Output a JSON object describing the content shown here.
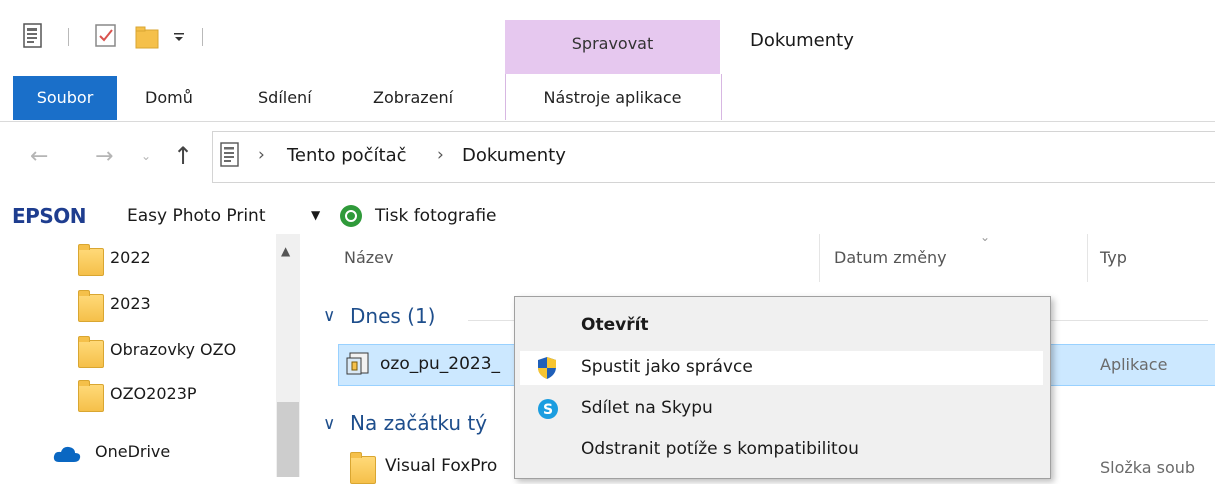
{
  "window": {
    "title": "Dokumenty"
  },
  "ribbon": {
    "contextual_group": "Spravovat",
    "tabs": [
      "Soubor",
      "Domů",
      "Sdílení",
      "Zobrazení",
      "Nástroje aplikace"
    ],
    "active_tab": "Soubor"
  },
  "address_bar": {
    "segments": [
      "Tento počítač",
      "Dokumenty"
    ],
    "separator": "›"
  },
  "epson_toolbar": {
    "brand": "EPSON",
    "app": "Easy Photo Print",
    "action": "Tisk fotografie"
  },
  "nav_pane": {
    "items": [
      {
        "label": "2022",
        "icon": "folder-icon"
      },
      {
        "label": "2023",
        "icon": "folder-icon"
      },
      {
        "label": "Obrazovky OZO",
        "icon": "folder-icon"
      },
      {
        "label": "OZO2023P",
        "icon": "folder-icon"
      },
      {
        "label": "OneDrive",
        "icon": "cloud-icon"
      }
    ]
  },
  "file_list": {
    "columns": [
      "Název",
      "Datum změny",
      "Typ"
    ],
    "groups": [
      {
        "label": "Dnes (1)"
      },
      {
        "label": "Na začátku tý"
      }
    ],
    "rows": [
      {
        "name": "ozo_pu_2023_",
        "type": "Aplikace",
        "selected": true
      },
      {
        "name": "Visual FoxPro",
        "type": "Složka soub"
      }
    ]
  },
  "context_menu": {
    "items": [
      {
        "label": "Otevřít",
        "bold": true,
        "icon": ""
      },
      {
        "label": "Spustit jako správce",
        "icon": "uac-shield-icon",
        "highlighted": true
      },
      {
        "label": "Sdílet na Skypu",
        "icon": "skype-icon"
      },
      {
        "label": "Odstranit potíže s kompatibilitou",
        "icon": ""
      }
    ]
  },
  "colors": {
    "accent": "#1a6fc9",
    "contextual": "#e6c8ef",
    "selection": "#cce8ff"
  }
}
